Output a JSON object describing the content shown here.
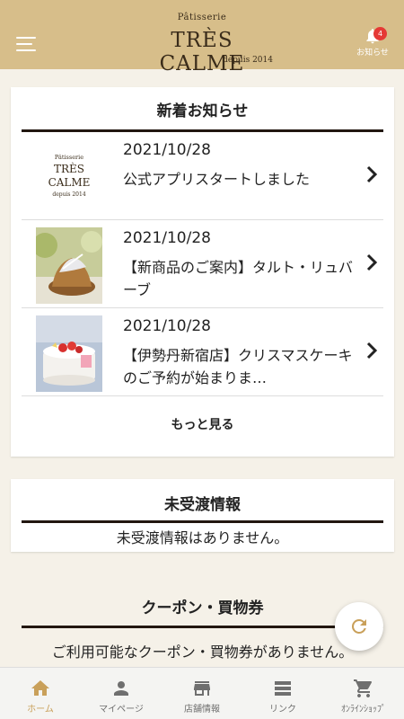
{
  "header": {
    "logo_small": "Pâtisserie",
    "logo_big": "TRÈS CALME",
    "logo_since": "depuis 2014",
    "notice_label": "お知らせ",
    "notice_badge": "4"
  },
  "news": {
    "title": "新着お知らせ",
    "items": [
      {
        "date": "2021/10/28",
        "text": "公式アプリスタートしました",
        "thumb": "logo"
      },
      {
        "date": "2021/10/28",
        "text": "【新商品のご案内】タルト・リュバーブ",
        "thumb": "tart"
      },
      {
        "date": "2021/10/28",
        "text": "【伊勢丹新宿店】クリスマスケーキのご予約が始まりま…",
        "thumb": "cake"
      }
    ],
    "more_label": "もっと見る"
  },
  "undelivered": {
    "title": "未受渡情報",
    "message": "未受渡情報はありません。"
  },
  "coupon": {
    "title": "クーポン・買物券",
    "message": "ご利用可能なクーポン・買物券がありません。"
  },
  "bottom_nav": [
    {
      "label": "ホーム",
      "icon": "home-icon",
      "active": true
    },
    {
      "label": "マイページ",
      "icon": "person-icon",
      "active": false
    },
    {
      "label": "店舗情報",
      "icon": "store-icon",
      "active": false
    },
    {
      "label": "リンク",
      "icon": "list-icon",
      "active": false
    },
    {
      "label": "ｵﾝﾗｲﾝｼｮｯﾌﾟ",
      "icon": "cart-icon",
      "active": false
    }
  ],
  "colors": {
    "header": "#d7be8a",
    "accent": "#c9a05a",
    "badge": "#e53935",
    "rule": "#221710"
  }
}
